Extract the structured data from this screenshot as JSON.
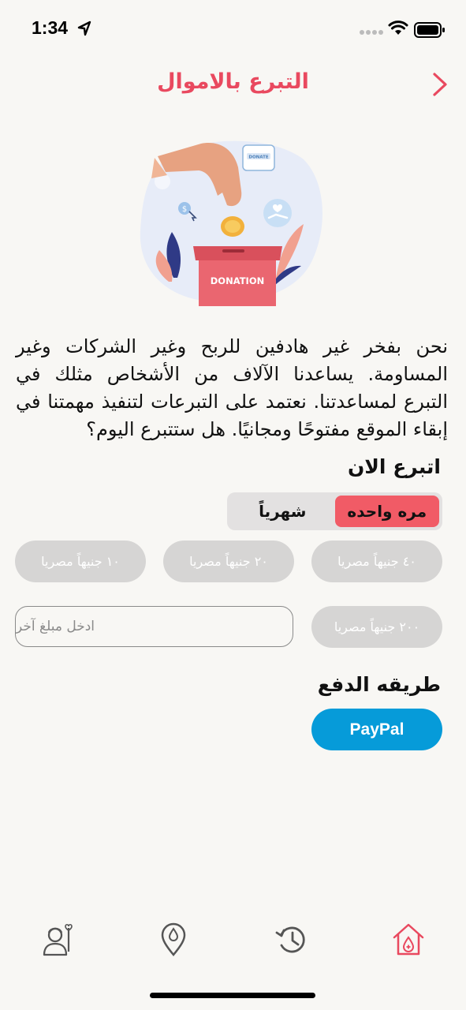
{
  "status_bar": {
    "time": "1:34"
  },
  "header": {
    "title": "التبرع بالاموال"
  },
  "illustration": {
    "donation_box_label": "DONATION",
    "donate_button_label": "DONATE"
  },
  "intro": {
    "text": "نحن بفخر غير هادفين للربح وغير الشركات وغير المساومة. يساعدنا الآلاف من الأشخاص مثلك في التبرع لمساعدتنا. نعتمد على التبرعات لتنفيذ مهمتنا في إبقاء الموقع مفتوحًا ومجانيًا. هل ستتبرع اليوم؟"
  },
  "donate_now": {
    "title": "اتبرع الان",
    "frequency": {
      "options": [
        "مره واحده",
        "شهرياً"
      ],
      "selected": "مره واحده"
    },
    "amounts": [
      "٤٠ جنيهاً مصريا",
      "٢٠ جنيهاً مصريا",
      "١٠ جنيهاً مصريا",
      "٢٠٠ جنيهاً مصريا"
    ],
    "custom_placeholder": "ادخل مبلغ آخر"
  },
  "payment": {
    "title": "طريقه الدفع",
    "paypal_label": "PayPal"
  },
  "colors": {
    "accent": "#e9495f",
    "segment_active": "#f15b66",
    "paypal": "#069bd9",
    "amount_button": "#d6d5d4",
    "background": "#f8f7f4"
  },
  "tab_bar": {
    "items": [
      "home-icon",
      "history-icon",
      "location-icon",
      "profile-icon"
    ],
    "active": "home-icon"
  }
}
